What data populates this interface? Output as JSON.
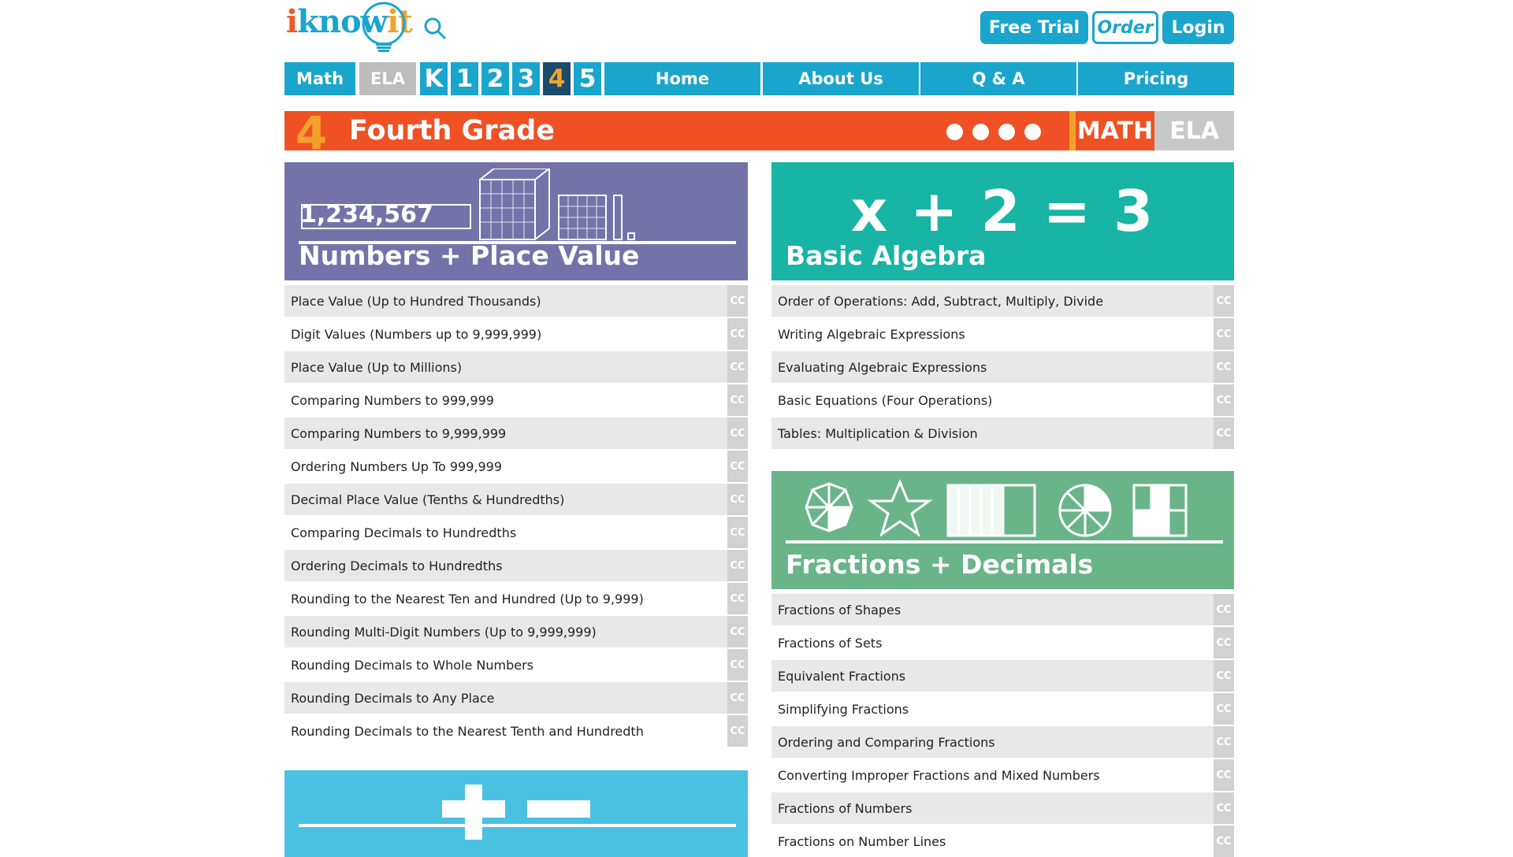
{
  "brand": {
    "logo_text_1": "i",
    "logo_text_2": "know",
    "logo_text_3": "it",
    "colors": {
      "orange": "#f05124",
      "blue": "#1aa5cc",
      "yellow": "#f2a22c",
      "navy": "#1b4b6b"
    }
  },
  "header": {
    "free_trial": "Free Trial",
    "order": "Order",
    "login": "Login"
  },
  "nav": {
    "math": "Math",
    "ela": "ELA",
    "grades": [
      "K",
      "1",
      "2",
      "3",
      "4",
      "5"
    ],
    "active_grade": "4",
    "links": [
      "Home",
      "About Us",
      "Q & A",
      "Pricing"
    ]
  },
  "banner": {
    "number": "4",
    "title": "Fourth Grade",
    "math": "MATH",
    "ela": "ELA"
  },
  "cards": {
    "numbers": {
      "title": "Numbers + Place Value",
      "digits": "1,234,567",
      "color": "#7373aa",
      "items": [
        "Place Value (Up to Hundred Thousands)",
        "Digit Values (Numbers up to 9,999,999)",
        "Place Value (Up to Millions)",
        "Comparing Numbers to 999,999",
        "Comparing Numbers to 9,999,999",
        "Ordering Numbers Up To 999,999",
        "Decimal Place Value (Tenths & Hundredths)",
        "Comparing Decimals to Hundredths",
        "Ordering Decimals to Hundredths",
        "Rounding to the Nearest Ten and Hundred (Up to 9,999)",
        "Rounding Multi-Digit Numbers (Up to 9,999,999)",
        "Rounding Decimals to Whole Numbers",
        "Rounding Decimals to Any Place",
        "Rounding Decimals to the Nearest Tenth and Hundredth"
      ]
    },
    "algebra": {
      "title": "Basic Algebra",
      "equation": "x + 2 = 3",
      "color": "#18b4a6",
      "items": [
        "Order of Operations: Add, Subtract, Multiply, Divide",
        "Writing Algebraic Expressions",
        "Evaluating Algebraic Expressions",
        "Basic Equations (Four Operations)",
        "Tables: Multiplication & Division"
      ]
    },
    "fractions": {
      "title": "Fractions + Decimals",
      "color": "#6ab48a",
      "items": [
        "Fractions of Shapes",
        "Fractions of Sets",
        "Equivalent Fractions",
        "Simplifying Fractions",
        "Ordering and Comparing Fractions",
        "Converting Improper Fractions and Mixed Numbers",
        "Fractions of Numbers",
        "Fractions on Number Lines"
      ]
    },
    "addsub": {
      "color": "#4bc1e2"
    }
  },
  "cc_label": "CC"
}
